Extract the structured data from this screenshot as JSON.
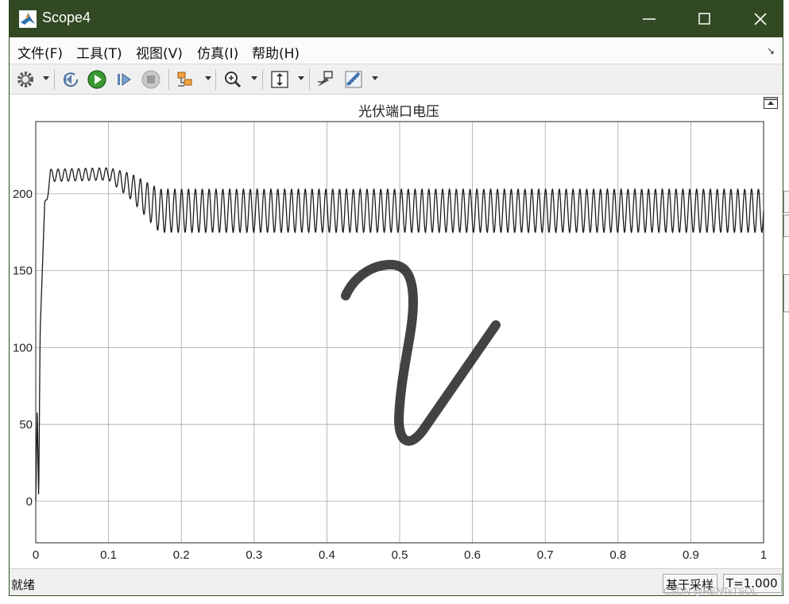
{
  "window": {
    "title": "Scope4",
    "icon": "matlab-logo-icon",
    "controls": [
      "minimize-icon",
      "maximize-icon",
      "close-icon"
    ]
  },
  "menu": {
    "items": [
      {
        "label": "文件(F)"
      },
      {
        "label": "工具(T)"
      },
      {
        "label": "视图(V)"
      },
      {
        "label": "仿真(I)"
      },
      {
        "label": "帮助(H)"
      }
    ],
    "dock_arrow": "↘"
  },
  "toolbar": {
    "buttons": [
      "gear-icon",
      "step-back-icon",
      "run-icon",
      "step-forward-icon",
      "stop-icon",
      "signal-triggers-icon",
      "zoom-in-icon",
      "autoscale-icon",
      "highlight-block-icon",
      "measurement-ruler-icon"
    ]
  },
  "plot": {
    "title": "光伏端口电压",
    "xticks": [
      "0",
      "0.1",
      "0.2",
      "0.3",
      "0.4",
      "0.5",
      "0.6",
      "0.7",
      "0.8",
      "0.9",
      "1"
    ],
    "yticks": [
      "0",
      "50",
      "100",
      "150",
      "200"
    ],
    "annotation": "hand-drawn-scribble"
  },
  "chart_data": {
    "type": "line",
    "title": "光伏端口电压",
    "xlabel": "",
    "ylabel": "",
    "xlim": [
      0,
      1
    ],
    "ylim": [
      -27,
      247
    ],
    "grid": true,
    "line_color": "#1a1a1a",
    "series": [
      {
        "description": "PV terminal voltage: rapid rise at start to ~215 with ±4 ripple, transitions near 0.1–0.17 into steady oscillation between ~175 and ~203",
        "points": [
          {
            "x": 0.0,
            "y": 0
          },
          {
            "x": 0.002,
            "y": 60
          },
          {
            "x": 0.004,
            "y": 0
          },
          {
            "x": 0.006,
            "y": 110
          },
          {
            "x": 0.012,
            "y": 190
          },
          {
            "x": 0.02,
            "y": 212
          },
          {
            "x": 0.1,
            "y": 213
          },
          {
            "x": 0.13,
            "y": 205
          },
          {
            "x": 0.17,
            "y": 189
          },
          {
            "x": 0.5,
            "y": 189
          },
          {
            "x": 1.0,
            "y": 189
          }
        ],
        "ripple_amplitude_initial": 4,
        "ripple_amplitude_steady": 14,
        "ripple_cycles": 106
      }
    ]
  },
  "status": {
    "ready": "就绪",
    "sample_mode": "基于采样",
    "time": "T=1.000"
  },
  "watermark": "CSDN @RENTsTSOL"
}
